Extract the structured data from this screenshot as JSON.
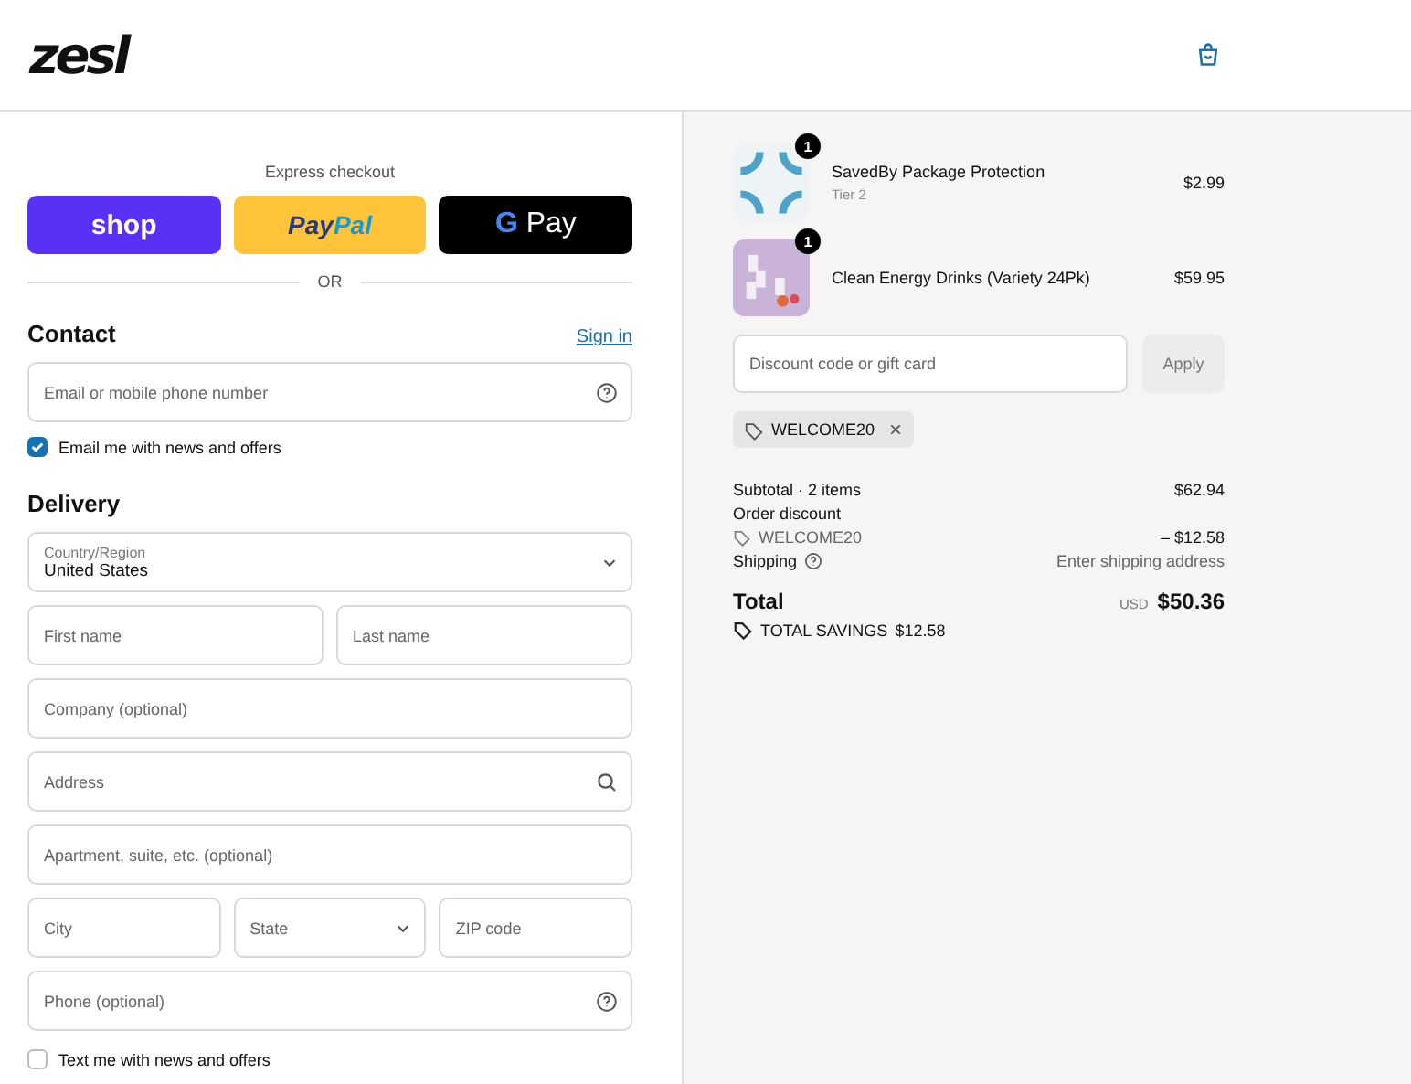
{
  "header": {
    "logo": "zesl"
  },
  "express": {
    "title": "Express checkout",
    "buttons": [
      {
        "kind": "shop",
        "label": "shop"
      },
      {
        "kind": "paypal",
        "label": "Pay",
        "label2": "Pal"
      },
      {
        "kind": "gpay",
        "label": "G",
        "label2": "Pay"
      }
    ],
    "divider": "OR"
  },
  "contact": {
    "title": "Contact",
    "link": "Sign in",
    "field": {
      "kind": "help",
      "placeholder": "Email or mobile phone number"
    },
    "newsletter": {
      "label": "Email me with news and offers",
      "checked": true
    }
  },
  "delivery": {
    "title": "Delivery",
    "rows": [
      [
        {
          "kind": "select",
          "label": "Country/Region",
          "value": "United States"
        }
      ],
      [
        {
          "kind": "text",
          "placeholder": "First name"
        },
        {
          "kind": "text",
          "placeholder": "Last name"
        }
      ],
      [
        {
          "kind": "text",
          "placeholder": "Company (optional)"
        }
      ],
      [
        {
          "kind": "search",
          "placeholder": "Address"
        }
      ],
      [
        {
          "kind": "text",
          "placeholder": "Apartment, suite, etc. (optional)"
        }
      ],
      [
        {
          "kind": "text",
          "placeholder": "City"
        },
        {
          "kind": "select",
          "placeholder": "State"
        },
        {
          "kind": "text",
          "placeholder": "ZIP code"
        }
      ],
      [
        {
          "kind": "help",
          "placeholder": "Phone (optional)"
        }
      ]
    ],
    "sms": {
      "label": "Text me with news and offers",
      "checked": false
    }
  },
  "summary": {
    "items": [
      {
        "kind": "protection",
        "name": "SavedBy Package Protection",
        "variant": "Tier 2",
        "quantity": "1",
        "price": "$2.99"
      },
      {
        "kind": "drinks",
        "name": "Clean Energy Drinks (Variety 24Pk)",
        "quantity": "1",
        "price": "$59.95"
      }
    ],
    "discount": {
      "placeholder": "Discount code or gift card",
      "button": "Apply",
      "applied": "WELCOME20",
      "remove": "×"
    },
    "lines": [
      {
        "kind": "plain",
        "label": "Subtotal · 2 items",
        "value": "$62.94"
      },
      {
        "kind": "plain",
        "label": "Order discount"
      },
      {
        "kind": "code",
        "label": "WELCOME20",
        "value": "– $12.58"
      },
      {
        "kind": "help",
        "label": "Shipping",
        "value": "Enter shipping address"
      }
    ],
    "total": {
      "label": "Total",
      "currency": "USD",
      "value": "$50.36",
      "savings_label": "TOTAL SAVINGS",
      "savings": "$12.58"
    }
  }
}
